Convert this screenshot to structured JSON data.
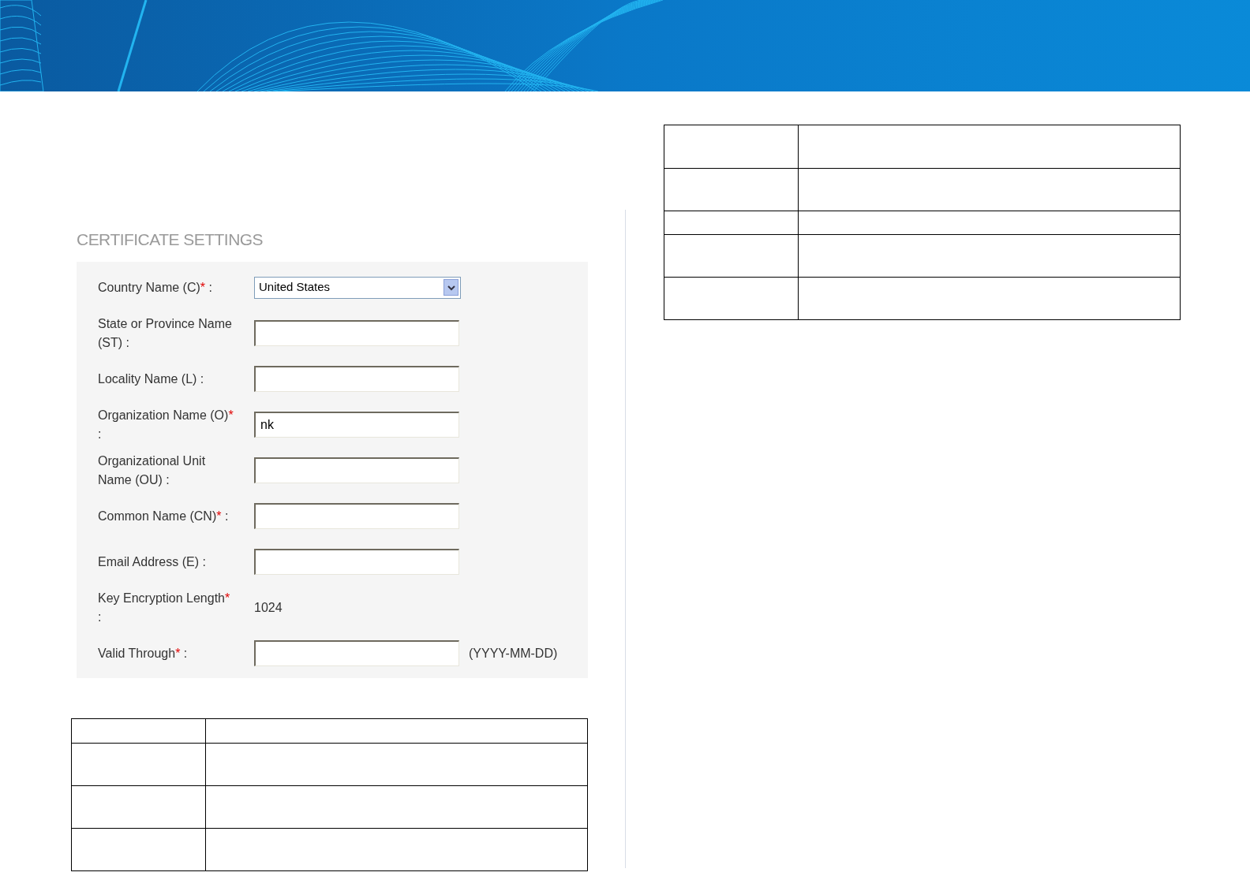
{
  "form": {
    "title": "CERTIFICATE SETTINGS",
    "required_mark": "*",
    "fields": [
      {
        "kind": "select",
        "label": "Country Name (C)",
        "required": true,
        "suffix": ":",
        "value": "United States"
      },
      {
        "kind": "text",
        "label": "State or Province Name (ST)",
        "required": false,
        "suffix": ":"
      },
      {
        "kind": "text",
        "label": "Locality Name (L)",
        "required": false,
        "suffix": ":"
      },
      {
        "kind": "text",
        "label": "Organization Name (O)",
        "required": true,
        "suffix": ":",
        "value": "nk"
      },
      {
        "kind": "text",
        "label": "Organizational Unit Name (OU)",
        "required": false,
        "suffix": ":"
      },
      {
        "kind": "text",
        "label": "Common Name (CN)",
        "required": true,
        "suffix": ":"
      },
      {
        "kind": "text",
        "label": "Email Address (E)",
        "required": false,
        "suffix": ":"
      },
      {
        "kind": "static",
        "label": "Key Encryption Length",
        "required": true,
        "suffix": ":",
        "value": "1024"
      },
      {
        "kind": "text",
        "label": "Valid Through",
        "required": true,
        "suffix": ":",
        "hint": "(YYYY-MM-DD)"
      }
    ]
  }
}
